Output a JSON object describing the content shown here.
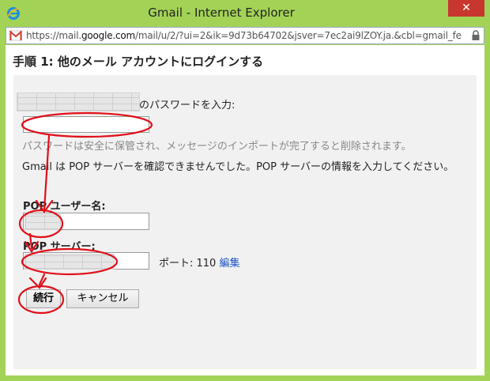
{
  "window": {
    "title": "Gmail - Internet Explorer",
    "close_label": "✕"
  },
  "address": {
    "prefix": "https://mail.",
    "domain": "google.com",
    "suffix": "/mail/u/2/?ui=2&ik=9d73b64702&jsver=7ec2ai9lZOY.ja.&cbl=gmail_fe"
  },
  "form": {
    "heading": "手順 1: 他のメール アカウントにログインする",
    "password_label": "のパスワードを入力:",
    "password_hint": "パスワードは安全に保管され、メッセージのインポートが完了すると削除されます。",
    "pop_error": "Gmail は POP サーバーを確認できませんでした。POP サーバーの情報を入力してください。",
    "pop_user_label": "POP ユーザー名:",
    "pop_server_label": "POP サーバー:",
    "port_label": "ポート: 110",
    "edit_link": "編集",
    "continue_button": "続行",
    "cancel_button": "キャンセル"
  },
  "colors": {
    "titlebar": "#a3d356",
    "close": "#c7372f",
    "annotation": "#e0101a",
    "link": "#1a52c4"
  },
  "icons": [
    "ie-icon",
    "gmail-icon",
    "lock-icon",
    "close-icon"
  ]
}
